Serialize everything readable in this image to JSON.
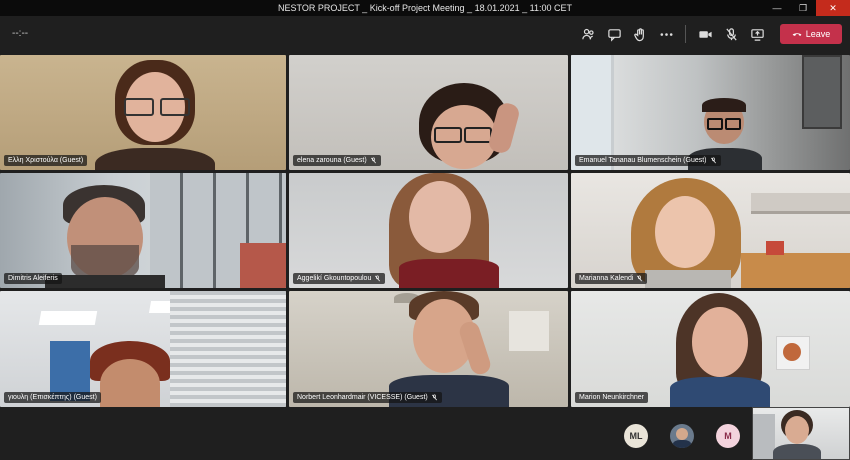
{
  "window": {
    "title": "NESTOR PROJECT _ Kick-off Project Meeting _ 18.01.2021 _ 11:00 CET"
  },
  "toolbar": {
    "timer": "--:--",
    "leave_label": "Leave"
  },
  "participants": [
    {
      "name": "Ελλη Χριστούλα (Guest)",
      "muted": false
    },
    {
      "name": "elena zarouna (Guest)",
      "muted": true
    },
    {
      "name": "Emanuel Tananau Blumenschein (Guest)",
      "muted": true
    },
    {
      "name": "Dimitris Aleiferis",
      "muted": false
    },
    {
      "name": "Aggelikí Gkountopoulou",
      "muted": true
    },
    {
      "name": "Marianna Kalendi",
      "muted": true
    },
    {
      "name": "γιουλη (Επισκέπτης) (Guest)",
      "muted": false
    },
    {
      "name": "Norbert Leonhardmair (VICESSE) (Guest)",
      "muted": true
    },
    {
      "name": "Marion Neunkirchner",
      "muted": false
    }
  ],
  "avatars": [
    {
      "initials": "ML",
      "bg": "#e9e4d8",
      "fg": "#333333"
    },
    {
      "initials": "",
      "bg": "#6a7a8c",
      "fg": "#ffffff"
    },
    {
      "initials": "M",
      "bg": "#f3d3dd",
      "fg": "#8a2b4a"
    }
  ],
  "colors": {
    "leave": "#c4314b",
    "background": "#1f1f1f"
  }
}
